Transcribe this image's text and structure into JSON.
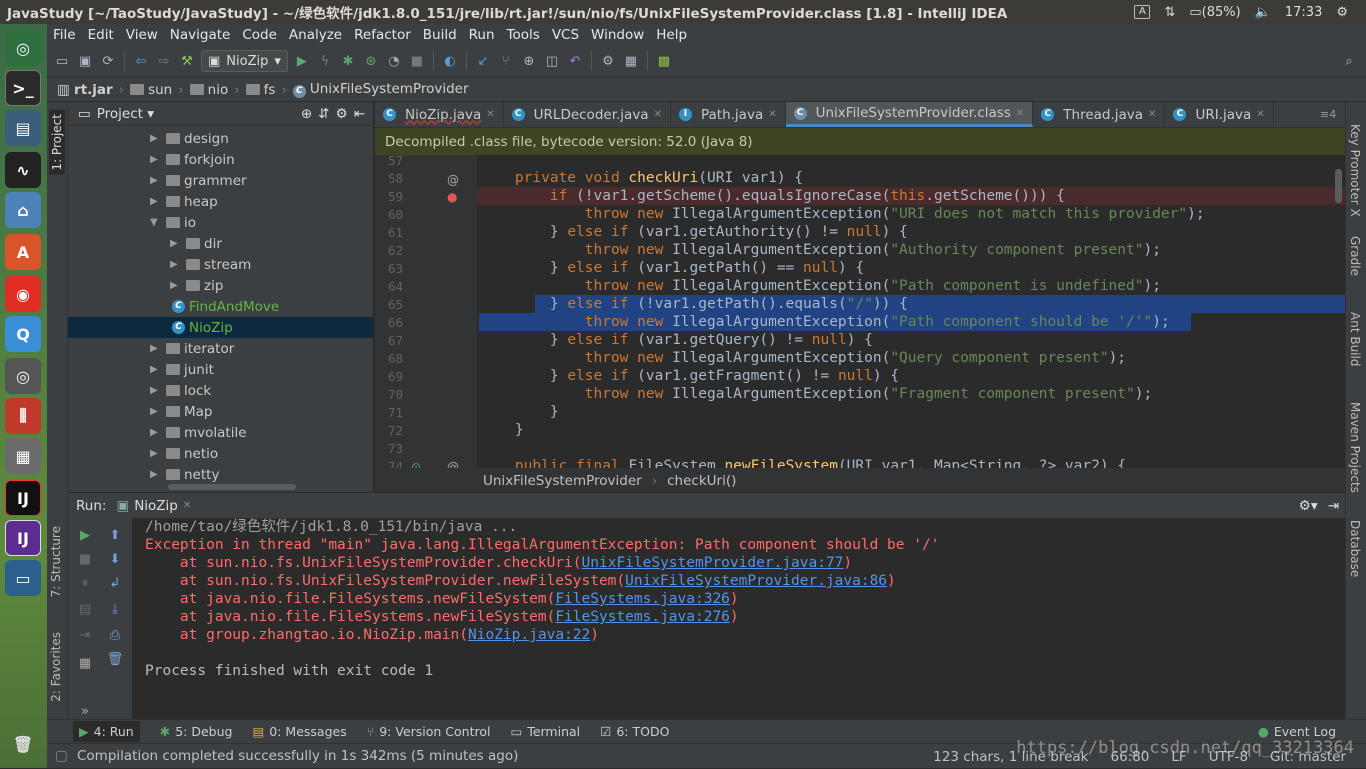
{
  "window": {
    "title": "JavaStudy [~/TaoStudy/JavaStudy] - ~/绿色软件/jdk1.8.0_151/jre/lib/rt.jar!/sun/nio/fs/UnixFileSystemProvider.class [1.8] - IntelliJ IDEA",
    "tray": {
      "battery": "(85%)",
      "time": "17:33"
    }
  },
  "menu": [
    "File",
    "Edit",
    "View",
    "Navigate",
    "Code",
    "Analyze",
    "Refactor",
    "Build",
    "Run",
    "Tools",
    "VCS",
    "Window",
    "Help"
  ],
  "toolbar": {
    "run_config": "NioZip"
  },
  "breadcrumb": [
    "rt.jar",
    "sun",
    "nio",
    "fs",
    "UnixFileSystemProvider"
  ],
  "project": {
    "title": "Project",
    "items": [
      {
        "label": "design",
        "indent": 0,
        "type": "folder"
      },
      {
        "label": "forkjoin",
        "indent": 0,
        "type": "folder"
      },
      {
        "label": "grammer",
        "indent": 0,
        "type": "folder"
      },
      {
        "label": "heap",
        "indent": 0,
        "type": "folder"
      },
      {
        "label": "io",
        "indent": 0,
        "type": "folder-open"
      },
      {
        "label": "dir",
        "indent": 1,
        "type": "folder"
      },
      {
        "label": "stream",
        "indent": 1,
        "type": "folder"
      },
      {
        "label": "zip",
        "indent": 1,
        "type": "folder"
      },
      {
        "label": "FindAndMove",
        "indent": 1,
        "type": "class"
      },
      {
        "label": "NioZip",
        "indent": 1,
        "type": "class",
        "selected": true
      },
      {
        "label": "iterator",
        "indent": 0,
        "type": "folder"
      },
      {
        "label": "junit",
        "indent": 0,
        "type": "folder"
      },
      {
        "label": "lock",
        "indent": 0,
        "type": "folder"
      },
      {
        "label": "Map",
        "indent": 0,
        "type": "folder"
      },
      {
        "label": "mvolatile",
        "indent": 0,
        "type": "folder"
      },
      {
        "label": "netio",
        "indent": 0,
        "type": "folder"
      },
      {
        "label": "netty",
        "indent": 0,
        "type": "folder"
      }
    ]
  },
  "side_tools": {
    "left": [
      "1: Project",
      "7: Structure",
      "2: Favorites"
    ],
    "right": [
      "Key Promoter X",
      "Gradle",
      "Ant Build",
      "Maven Projects",
      "Database"
    ]
  },
  "tabs": [
    {
      "label": "NioZip.java",
      "active": false
    },
    {
      "label": "URLDecoder.java",
      "active": false
    },
    {
      "label": "Path.java",
      "active": false
    },
    {
      "label": "UnixFileSystemProvider.class",
      "active": true
    },
    {
      "label": "Thread.java",
      "active": false
    },
    {
      "label": "URI.java",
      "active": false
    }
  ],
  "tabs_overflow": "≡4",
  "banner": "Decompiled .class file, bytecode version: 52.0 (Java 8)",
  "code": {
    "lines": [
      {
        "n": "57",
        "parts": []
      },
      {
        "n": "58",
        "parts": [
          [
            "kw",
            "    private void "
          ],
          [
            "fn",
            "checkUri"
          ],
          [
            "",
            "(URI var1) {"
          ]
        ]
      },
      {
        "n": "59",
        "parts": [
          [
            "kw",
            "        if "
          ],
          [
            "",
            "(!var1.getScheme().equalsIgnoreCase("
          ],
          [
            "kw",
            "this"
          ],
          [
            "",
            ".getScheme())) {"
          ]
        ]
      },
      {
        "n": "60",
        "parts": [
          [
            "kw",
            "            throw new "
          ],
          [
            "",
            "IllegalArgumentException("
          ],
          [
            "str",
            "\"URI does not match this provider\""
          ],
          [
            "",
            ");"
          ]
        ]
      },
      {
        "n": "61",
        "parts": [
          [
            "",
            "        } "
          ],
          [
            "kw",
            "else if "
          ],
          [
            "",
            "(var1.getAuthority() != "
          ],
          [
            "kw",
            "null"
          ],
          [
            "",
            ") {"
          ]
        ]
      },
      {
        "n": "62",
        "parts": [
          [
            "kw",
            "            throw new "
          ],
          [
            "",
            "IllegalArgumentException("
          ],
          [
            "str",
            "\"Authority component present\""
          ],
          [
            "",
            ");"
          ]
        ]
      },
      {
        "n": "63",
        "parts": [
          [
            "",
            "        } "
          ],
          [
            "kw",
            "else if "
          ],
          [
            "",
            "(var1.getPath() == "
          ],
          [
            "kw",
            "null"
          ],
          [
            "",
            ") {"
          ]
        ]
      },
      {
        "n": "64",
        "parts": [
          [
            "kw",
            "            throw new "
          ],
          [
            "",
            "IllegalArgumentException("
          ],
          [
            "str",
            "\"Path component is undefined\""
          ],
          [
            "",
            ");"
          ]
        ]
      },
      {
        "n": "65",
        "parts": [
          [
            "",
            "        } "
          ],
          [
            "kw",
            "else if "
          ],
          [
            "",
            "(!var1.getPath().equals("
          ],
          [
            "str",
            "\"/\""
          ],
          [
            "",
            ")) {"
          ]
        ]
      },
      {
        "n": "66",
        "parts": [
          [
            "kw",
            "            throw new "
          ],
          [
            "",
            "IllegalArgumentException("
          ],
          [
            "str",
            "\"Path component should be '/'\""
          ],
          [
            "",
            ");"
          ]
        ]
      },
      {
        "n": "67",
        "parts": [
          [
            "",
            "        } "
          ],
          [
            "kw",
            "else if "
          ],
          [
            "",
            "(var1.getQuery() != "
          ],
          [
            "kw",
            "null"
          ],
          [
            "",
            ") {"
          ]
        ]
      },
      {
        "n": "68",
        "parts": [
          [
            "kw",
            "            throw new "
          ],
          [
            "",
            "IllegalArgumentException("
          ],
          [
            "str",
            "\"Query component present\""
          ],
          [
            "",
            ");"
          ]
        ]
      },
      {
        "n": "69",
        "parts": [
          [
            "",
            "        } "
          ],
          [
            "kw",
            "else if "
          ],
          [
            "",
            "(var1.getFragment() != "
          ],
          [
            "kw",
            "null"
          ],
          [
            "",
            ") {"
          ]
        ]
      },
      {
        "n": "70",
        "parts": [
          [
            "kw",
            "            throw new "
          ],
          [
            "",
            "IllegalArgumentException("
          ],
          [
            "str",
            "\"Fragment component present\""
          ],
          [
            "",
            ");"
          ]
        ]
      },
      {
        "n": "71",
        "parts": [
          [
            "",
            "        }"
          ]
        ]
      },
      {
        "n": "72",
        "parts": [
          [
            "",
            "    }"
          ]
        ]
      },
      {
        "n": "73",
        "parts": []
      },
      {
        "n": "74",
        "parts": [
          [
            "kw",
            "    public final "
          ],
          [
            "",
            "FileSystem "
          ],
          [
            "fn",
            "newFileSystem"
          ],
          [
            "",
            "(URI var1, Map<String, ?> var2) {"
          ]
        ]
      }
    ]
  },
  "editor_breadcrumb": [
    "UnixFileSystemProvider",
    "checkUri()"
  ],
  "run": {
    "label": "Run:",
    "config": "NioZip",
    "console": [
      {
        "kind": "gray",
        "text": "/home/tao/绿色软件/jdk1.8.0_151/bin/java ..."
      },
      {
        "kind": "err",
        "text": "Exception in thread \"main\" java.lang.IllegalArgumentException: Path component should be '/'"
      },
      {
        "kind": "trace",
        "pre": "    at sun.nio.fs.UnixFileSystemProvider.checkUri(",
        "link": "UnixFileSystemProvider.java:77",
        "post": ")"
      },
      {
        "kind": "trace",
        "pre": "    at sun.nio.fs.UnixFileSystemProvider.newFileSystem(",
        "link": "UnixFileSystemProvider.java:86",
        "post": ")"
      },
      {
        "kind": "trace",
        "pre": "    at java.nio.file.FileSystems.newFileSystem(",
        "link": "FileSystems.java:326",
        "post": ")"
      },
      {
        "kind": "trace",
        "pre": "    at java.nio.file.FileSystems.newFileSystem(",
        "link": "FileSystems.java:276",
        "post": ")"
      },
      {
        "kind": "trace",
        "pre": "    at group.zhangtao.io.NioZip.main(",
        "link": "NioZip.java:22",
        "post": ")"
      },
      {
        "kind": "plain",
        "text": ""
      },
      {
        "kind": "plain",
        "text": "Process finished with exit code 1"
      }
    ]
  },
  "bottom_tabs": [
    {
      "key": "4",
      "label": "4: Run",
      "active": true
    },
    {
      "key": "5",
      "label": "5: Debug"
    },
    {
      "key": "0",
      "label": "0: Messages"
    },
    {
      "key": "9",
      "label": "9: Version Control"
    },
    {
      "key": "T",
      "label": "Terminal"
    },
    {
      "key": "6",
      "label": "6: TODO"
    }
  ],
  "event_log": "Event Log",
  "status": {
    "message": "Compilation completed successfully in 1s 342ms (5 minutes ago)",
    "chars": "123 chars, 1 line break",
    "position": "66:80",
    "line_sep": "LF",
    "encoding": "UTF-8",
    "git": "Git: master"
  },
  "watermark": "https://blog.csdn.net/qq_33213364",
  "colors": {
    "keyword": "#cc7832",
    "string": "#6a8759",
    "selection": "#214283",
    "error": "#ff6b68",
    "link": "#5394ec"
  }
}
